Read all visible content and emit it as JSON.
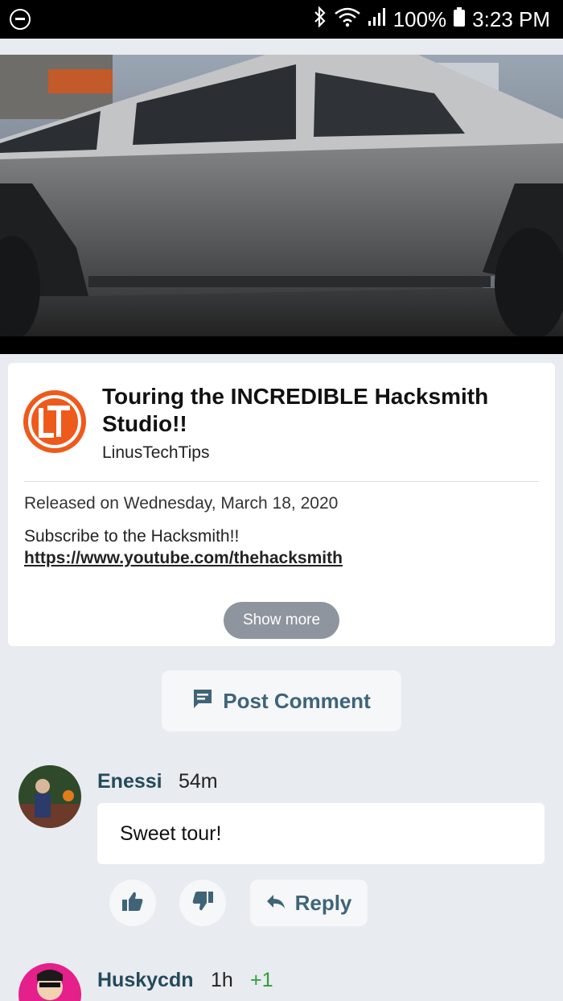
{
  "status_bar": {
    "battery": "100%",
    "time": "3:23 PM",
    "icons": [
      "do-not-disturb-icon",
      "bluetooth-icon",
      "wifi-icon",
      "signal-icon",
      "battery-icon"
    ]
  },
  "video": {
    "thumbnail": "truck-video-frame"
  },
  "info": {
    "title": "Touring the INCREDIBLE Hacksmith Studio!!",
    "channel": "LinusTechTips",
    "channel_logo_text": "LTT",
    "released": "Released on Wednesday, March 18, 2020",
    "description": "Subscribe to the Hacksmith!!",
    "link": "https://www.youtube.com/thehacksmith",
    "show_more": "Show more"
  },
  "post_comment": {
    "label": "Post Comment"
  },
  "comments": [
    {
      "author": "Enessi",
      "time": "54m",
      "text": "Sweet tour!",
      "reply_label": "Reply"
    },
    {
      "author": "Huskycdn",
      "time": "1h",
      "score": "+1"
    }
  ],
  "colors": {
    "accent": "#3f6478",
    "author": "#244a5c",
    "score_positive": "#2e9d3a",
    "brand_orange": "#ee5a1c",
    "background": "#e8ebef"
  }
}
